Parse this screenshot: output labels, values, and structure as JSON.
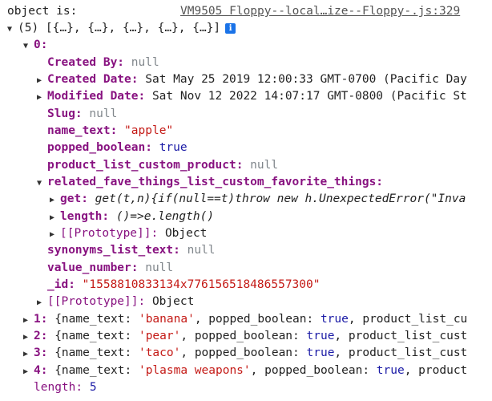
{
  "log": {
    "label": "object is:",
    "source_link": "VM9505 Floppy--local…ize--Floppy-.js:329"
  },
  "array": {
    "summary": "(5) [{…}, {…}, {…}, {…}, {…}]",
    "info_icon": "i",
    "item0_index": "0:",
    "item0": {
      "created_by_key": "Created By:",
      "created_by_value": "null",
      "created_date_key": "Created Date:",
      "created_date_value": "Sat May 25 2019 12:00:33 GMT-0700 (Pacific Day",
      "modified_date_key": "Modified Date:",
      "modified_date_value": "Sat Nov 12 2022 14:07:17 GMT-0800 (Pacific St",
      "slug_key": "Slug:",
      "slug_value": "null",
      "name_text_key": "name_text:",
      "name_text_value": "\"apple\"",
      "popped_boolean_key": "popped_boolean:",
      "popped_boolean_value": "true",
      "product_list_key": "product_list_custom_product:",
      "product_list_value": "null",
      "related_key": "related_fave_things_list_custom_favorite_things:",
      "related_get_key": "get:",
      "related_get_value": "get(t,n){if(null==t)throw new h.UnexpectedError(\"Inva",
      "related_length_key": "length:",
      "related_length_value": "()=>e.length()",
      "related_proto_key": "[[Prototype]]:",
      "related_proto_value": "Object",
      "synonyms_key": "synonyms_list_text:",
      "synonyms_value": "null",
      "value_number_key": "value_number:",
      "value_number_value": "null",
      "id_key": "_id:",
      "id_value": "\"1558810833134x776156518486557300\"",
      "proto_key": "[[Prototype]]:",
      "proto_value": "Object"
    },
    "items": [
      {
        "index": "1:",
        "open": "{name_text:",
        "name": "'banana'",
        "mid": ", popped_boolean:",
        "bool": "true",
        "tail": ", product_list_cu"
      },
      {
        "index": "2:",
        "open": "{name_text:",
        "name": "'pear'",
        "mid": ", popped_boolean:",
        "bool": "true",
        "tail": ", product_list_cust"
      },
      {
        "index": "3:",
        "open": "{name_text:",
        "name": "'taco'",
        "mid": ", popped_boolean:",
        "bool": "true",
        "tail": ", product_list_cust"
      },
      {
        "index": "4:",
        "open": "{name_text:",
        "name": "'plasma weapons'",
        "mid": ", popped_boolean:",
        "bool": "true",
        "tail": ", product"
      }
    ],
    "length_key": "length:",
    "length_value": "5"
  }
}
